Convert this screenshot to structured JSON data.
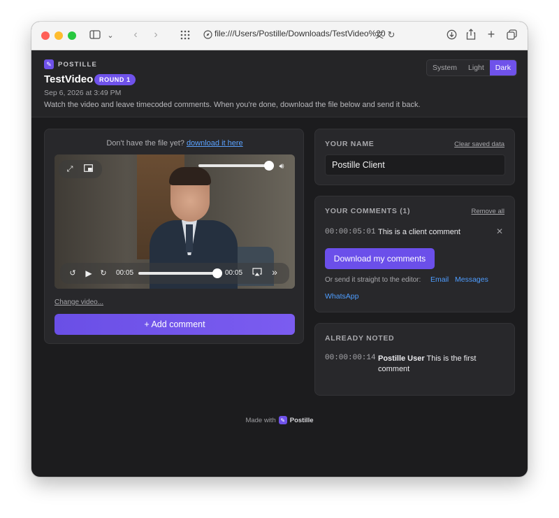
{
  "browser": {
    "url": "file:///Users/Postille/Downloads/TestVideo%20",
    "icons": [
      "sidebar-icon",
      "chevron-down-icon",
      "back-icon",
      "forward-icon",
      "tab-grid-icon",
      "compass-icon",
      "translate-icon",
      "reload-icon",
      "download-icon",
      "share-icon",
      "plus-icon",
      "tabs-icon"
    ]
  },
  "header": {
    "brand": "POSTILLE",
    "title": "TestVideo",
    "badge": "ROUND 1",
    "date": "Sep 6, 2026 at 3:49 PM",
    "description": "Watch the video and leave timecoded comments. When you're done, download the file below and send it back.",
    "theme": {
      "options": [
        "System",
        "Light",
        "Dark"
      ],
      "selected": "Dark"
    }
  },
  "player_card": {
    "note": "Don't have the file yet?",
    "note_link": "download it here",
    "current_time": "00:05",
    "duration": "00:05",
    "progress": 0.98,
    "volume": 0.9,
    "change_video": "Change video...",
    "add_comment": "+ Add comment"
  },
  "name_card": {
    "title": "YOUR NAME",
    "clear_link": "Clear saved data",
    "name_value": "Postille Client"
  },
  "comments_card": {
    "title": "YOUR COMMENTS (1)",
    "remove_all": "Remove all",
    "comments": [
      {
        "timecode": "00:00:05:01",
        "text": "This is a client comment"
      }
    ],
    "download_button": "Download my comments",
    "send_label": "Or send it straight to the editor:",
    "send_links": [
      "Email",
      "Messages",
      "WhatsApp"
    ]
  },
  "noted_card": {
    "title": "ALREADY NOTED",
    "items": [
      {
        "timecode": "00:00:00:14",
        "author": "Postille User",
        "text_line1": "This is the first",
        "text_line2": "comment"
      }
    ]
  },
  "footer": {
    "made_with": "Made with",
    "brand": "Postille"
  },
  "colors": {
    "accent": "#6f52ea",
    "link": "#4e9dff",
    "background": "#1c1c1e",
    "card": "#28282b"
  }
}
